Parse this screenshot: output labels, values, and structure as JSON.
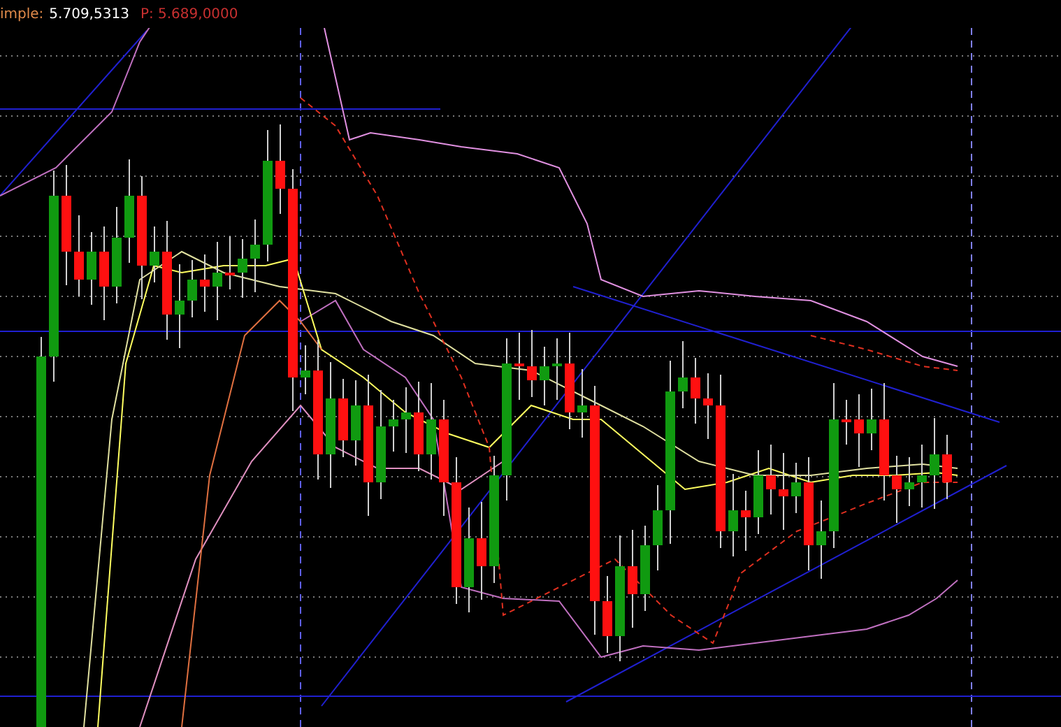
{
  "legend": {
    "label": "imple:",
    "value": "5.709,5313",
    "price": "P: 5.689,0000"
  }
}
